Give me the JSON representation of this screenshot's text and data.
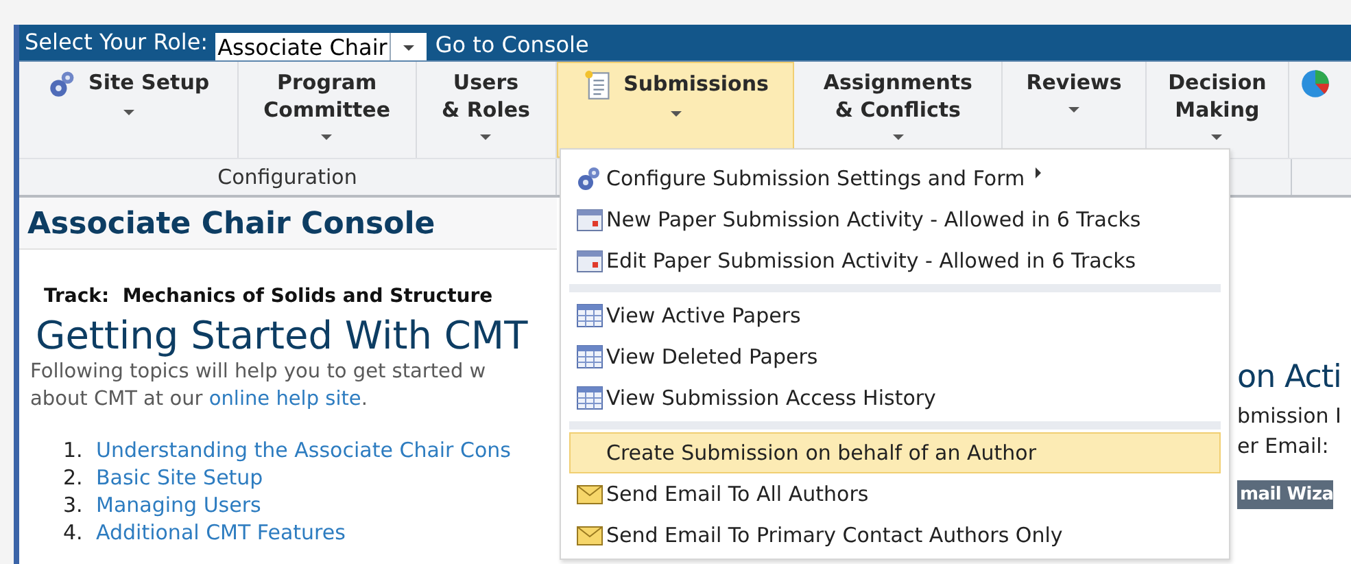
{
  "role_bar": {
    "label": "Select Your Role:",
    "role": "Associate Chair",
    "link": "Go to Console"
  },
  "ribbon": {
    "tabs": [
      {
        "label": "Site Setup",
        "selected": false
      },
      {
        "label": "Program\nCommittee",
        "selected": false
      },
      {
        "label": "Users\n& Roles",
        "selected": false
      },
      {
        "label": "Submissions",
        "selected": true
      },
      {
        "label": "Assignments\n& Conflicts",
        "selected": false
      },
      {
        "label": "Reviews",
        "selected": false
      },
      {
        "label": "Decision\nMaking",
        "selected": false
      }
    ],
    "group_label": "Configuration"
  },
  "console": {
    "title": "Associate Chair Console",
    "track_label": "Track:",
    "track": "Mechanics of Solids and Structure",
    "heading": "Getting Started With CMT",
    "intro": [
      {
        "text": "Following topics will help you to get started w"
      },
      {
        "text": "about CMT at our ",
        "link": "online help site",
        "end": "."
      }
    ],
    "topics": [
      {
        "number": "1.",
        "label": "Understanding the Associate Chair Cons"
      },
      {
        "number": "2.",
        "label": "Basic Site Setup"
      },
      {
        "number": "3.",
        "label": "Managing Users"
      },
      {
        "number": "4.",
        "label": "Additional CMT Features"
      }
    ],
    "side": {
      "heading": "on Acti",
      "line_1": "bmission I",
      "line_2": "er Email:",
      "button": "mail Wiza"
    }
  },
  "menu": {
    "items": [
      {
        "kind": "settings",
        "label": "Configure Submission Settings and Form",
        "submenu": true,
        "selected": false
      },
      {
        "kind": "activity",
        "label": "New Paper Submission Activity - Allowed in 6 Tracks",
        "submenu": false,
        "selected": false
      },
      {
        "kind": "activity",
        "label": "Edit Paper Submission Activity - Allowed in 6 Tracks",
        "submenu": false,
        "selected": false
      },
      {
        "kind": "separator"
      },
      {
        "kind": "list",
        "label": "View Active Papers",
        "submenu": false,
        "selected": false
      },
      {
        "kind": "list",
        "label": "View Deleted Papers",
        "submenu": false,
        "selected": false
      },
      {
        "kind": "list",
        "label": "View Submission Access History",
        "submenu": false,
        "selected": false
      },
      {
        "kind": "separator"
      },
      {
        "kind": "action",
        "label": "Create Submission on behalf of an Author",
        "submenu": false,
        "selected": true
      },
      {
        "kind": "email",
        "label": "Send Email To All Authors",
        "submenu": false,
        "selected": false
      },
      {
        "kind": "email",
        "label": "Send Email To Primary Contact Authors Only",
        "submenu": false,
        "selected": false
      }
    ]
  }
}
